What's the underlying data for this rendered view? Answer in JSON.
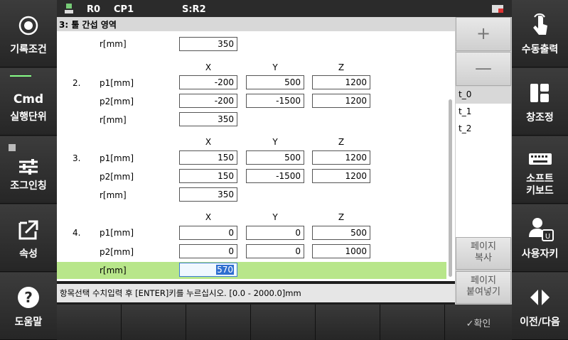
{
  "topbar": {
    "robot_icon": "robot-status-icon",
    "r": "R0",
    "cp": "CP1",
    "speed": "S:R2",
    "battery_icon": "battery-icon"
  },
  "title": "3: 툴 간섭 영역",
  "left_buttons": [
    {
      "label": "기록조건",
      "icon": "record-circle-icon"
    },
    {
      "label": "실행단위",
      "icon": "cmd-icon",
      "icon_text": "Cmd"
    },
    {
      "label": "조그인칭",
      "icon": "sliders-icon"
    },
    {
      "label": "속성",
      "icon": "external-link-icon"
    },
    {
      "label": "도움말",
      "icon": "help-icon"
    }
  ],
  "right_buttons": [
    {
      "label": "수동출력",
      "icon": "touch-hand-icon"
    },
    {
      "label": "창조정",
      "icon": "window-layout-icon"
    },
    {
      "label": "소프트\n키보드",
      "icon": "keyboard-icon"
    },
    {
      "label": "사용자키",
      "icon": "user-key-icon"
    },
    {
      "label": "이전/다음",
      "icon": "prev-next-icon"
    }
  ],
  "axes": {
    "x": "X",
    "y": "Y",
    "z": "Z"
  },
  "labels": {
    "p1": "p1[mm]",
    "p2": "p2[mm]",
    "r": "r[mm]"
  },
  "top_r": "350",
  "areas": [
    {
      "num": "2.",
      "p1": [
        "-200",
        "500",
        "1200"
      ],
      "p2": [
        "-200",
        "-1500",
        "1200"
      ],
      "r": "350"
    },
    {
      "num": "3.",
      "p1": [
        "150",
        "500",
        "1200"
      ],
      "p2": [
        "150",
        "-1500",
        "1200"
      ],
      "r": "350"
    },
    {
      "num": "4.",
      "p1": [
        "0",
        "0",
        "500"
      ],
      "p2": [
        "0",
        "0",
        "1000"
      ],
      "r": "570"
    }
  ],
  "status": "항목선택 수치입력 후 [ENTER]키를 누르십시오. [0.0 - 2000.0]mm",
  "side": {
    "plus": "+",
    "minus": "—",
    "tools": [
      "t_0",
      "t_1",
      "t_2"
    ],
    "copy": "페이지\n복사",
    "paste": "페이지\n붙여넣기"
  },
  "confirm": "✓확인"
}
